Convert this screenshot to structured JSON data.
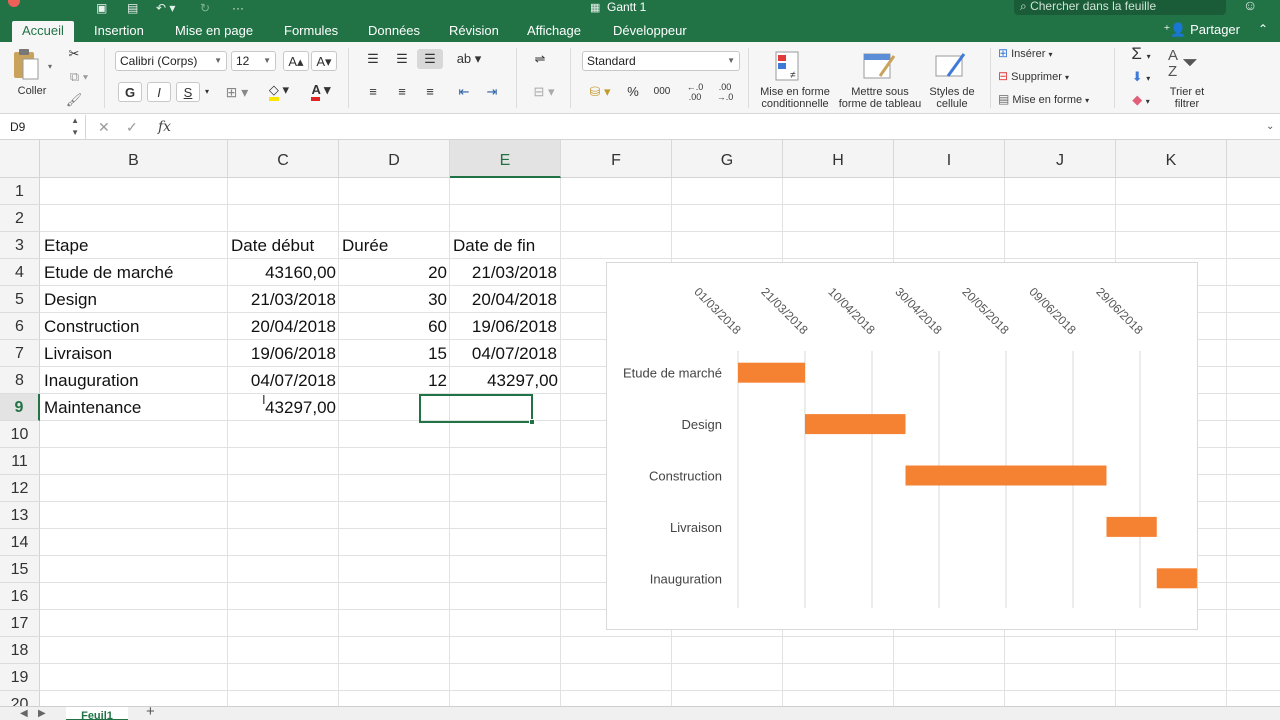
{
  "window": {
    "title": "Gantt 1",
    "search_placeholder": "Chercher dans la feuille"
  },
  "tabs": [
    {
      "label": "Accueil",
      "active": true
    },
    {
      "label": "Insertion"
    },
    {
      "label": "Mise en page"
    },
    {
      "label": "Formules"
    },
    {
      "label": "Données"
    },
    {
      "label": "Révision"
    },
    {
      "label": "Affichage"
    },
    {
      "label": "Développeur"
    }
  ],
  "share_label": "Partager",
  "ribbon": {
    "paste_label": "Coller",
    "font_name": "Calibri (Corps)",
    "font_size": "12",
    "bold": "G",
    "italic": "I",
    "underline": "S",
    "number_format": "Standard",
    "thousands": "000",
    "conditional_format": "Mise en forme conditionnelle",
    "format_table": "Mettre sous forme de tableau",
    "cell_styles": "Styles de cellule",
    "insert": "Insérer",
    "delete": "Supprimer",
    "format": "Mise en forme",
    "sort_filter": "Trier et filtrer"
  },
  "formula_bar": {
    "cell_ref": "D9",
    "formula": ""
  },
  "columns": [
    "B",
    "C",
    "D",
    "E",
    "F",
    "G",
    "H",
    "I",
    "J",
    "K"
  ],
  "selected_column": "E",
  "rows": [
    "1",
    "2",
    "3",
    "4",
    "5",
    "6",
    "7",
    "8",
    "9",
    "10",
    "11",
    "12",
    "13",
    "14",
    "15",
    "16",
    "17",
    "18",
    "19",
    "20"
  ],
  "selected_row": "9",
  "sheet": {
    "headers": {
      "b": "Etape",
      "c": "Date début",
      "d": "Durée",
      "e": "Date de fin"
    },
    "data": [
      {
        "b": "Etude de marché",
        "c": "43160,00",
        "d": "20",
        "e": "21/03/2018"
      },
      {
        "b": "Design",
        "c": "21/03/2018",
        "d": "30",
        "e": "20/04/2018"
      },
      {
        "b": "Construction",
        "c": "20/04/2018",
        "d": "60",
        "e": "19/06/2018"
      },
      {
        "b": "Livraison",
        "c": "19/06/2018",
        "d": "15",
        "e": "04/07/2018"
      },
      {
        "b": "Inauguration",
        "c": "04/07/2018",
        "d": "12",
        "e": "43297,00"
      },
      {
        "b": "Maintenance",
        "c": "43297,00",
        "d": "",
        "e": ""
      }
    ]
  },
  "chart_data": {
    "type": "bar",
    "orientation": "horizontal-gantt",
    "x_axis_position": "top",
    "x_ticks": [
      "01/03/2018",
      "21/03/2018",
      "10/04/2018",
      "30/04/2018",
      "20/05/2018",
      "09/06/2018",
      "29/06/2018"
    ],
    "categories": [
      "Etude de marché",
      "Design",
      "Construction",
      "Livraison",
      "Inauguration"
    ],
    "series": [
      {
        "start": [
          0,
          20,
          50,
          110,
          125
        ],
        "duration": [
          20,
          30,
          60,
          15,
          12
        ],
        "color": "#f58233"
      }
    ],
    "xlim": [
      "01/03/2018",
      "19/07/2018"
    ],
    "grid": true,
    "legend": "none"
  },
  "sheet_tabs": [
    {
      "label": "Feuil1",
      "active": true
    }
  ],
  "colors": {
    "accent": "#217346",
    "bar": "#f58233"
  }
}
